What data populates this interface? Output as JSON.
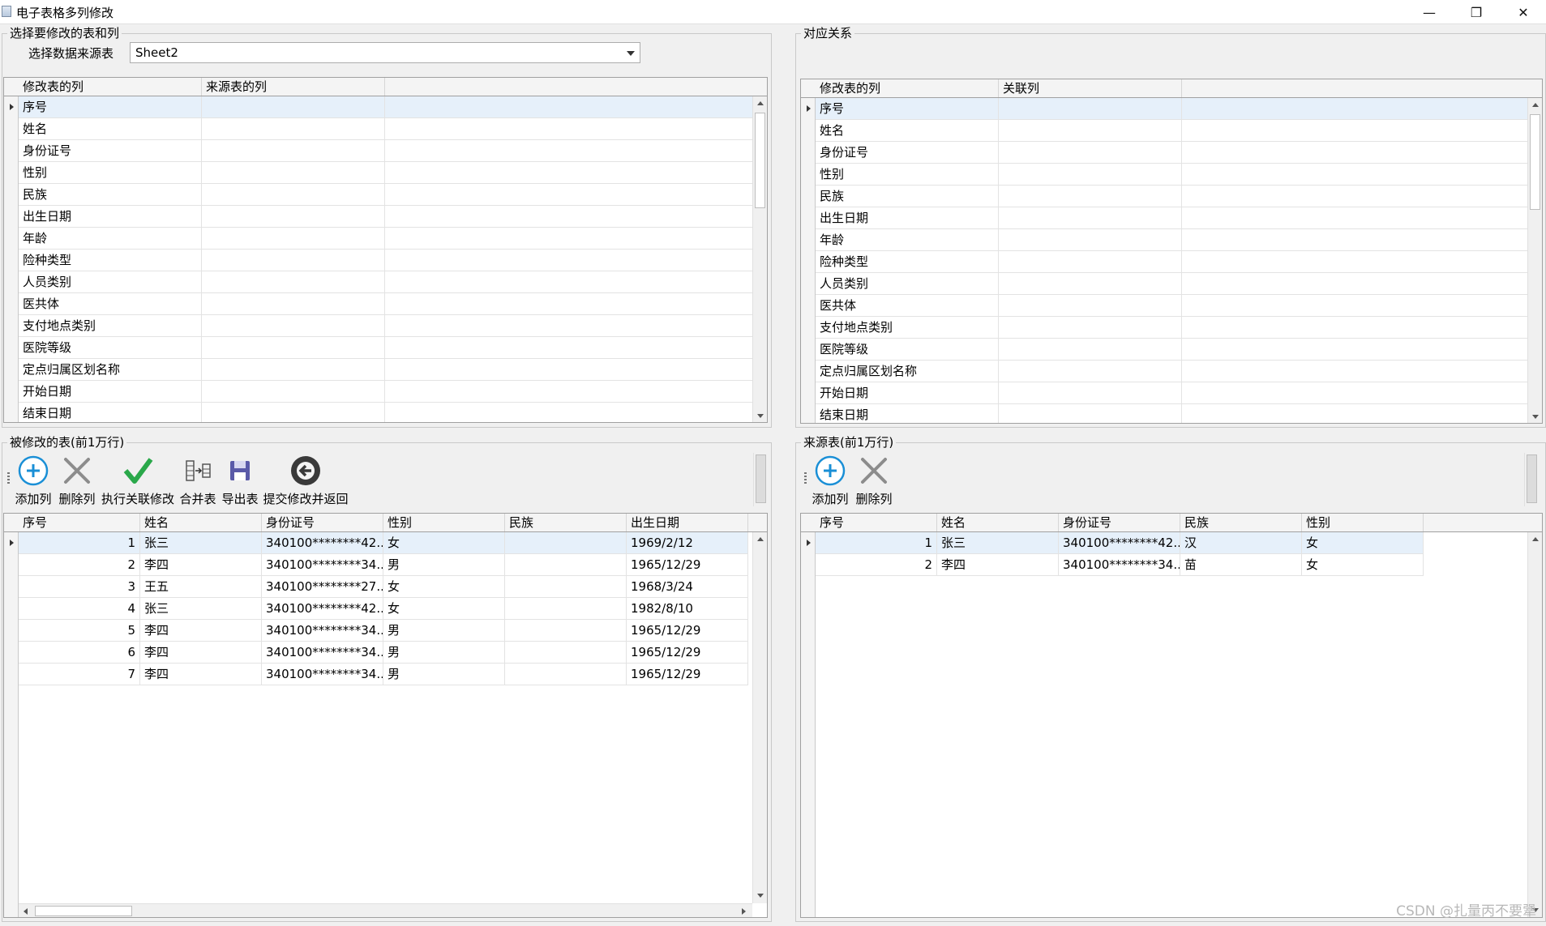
{
  "window": {
    "title": "电子表格多列修改",
    "minimize": "—",
    "restore": "❐",
    "close": "✕"
  },
  "select_group": {
    "title": "选择要修改的表和列",
    "source_label": "选择数据来源表",
    "source_value": "Sheet2",
    "columns": [
      "修改表的列",
      "来源表的列"
    ],
    "rows": [
      "序号",
      "姓名",
      "身份证号",
      "性别",
      "民族",
      "出生日期",
      "年龄",
      "险种类型",
      "人员类别",
      "医共体",
      "支付地点类别",
      "医院等级",
      "定点归属区划名称",
      "开始日期",
      "结束日期"
    ]
  },
  "mapping_group": {
    "title": "对应关系",
    "columns": [
      "修改表的列",
      "关联列"
    ],
    "rows": [
      "序号",
      "姓名",
      "身份证号",
      "性别",
      "民族",
      "出生日期",
      "年龄",
      "险种类型",
      "人员类别",
      "医共体",
      "支付地点类别",
      "医院等级",
      "定点归属区划名称",
      "开始日期",
      "结束日期"
    ]
  },
  "target_group": {
    "title": "被修改的表(前1万行)",
    "toolbar": [
      "添加列",
      "删除列",
      "执行关联修改",
      "合并表",
      "导出表",
      "提交修改并返回"
    ],
    "columns": [
      "序号",
      "姓名",
      "身份证号",
      "性别",
      "民族",
      "出生日期"
    ],
    "rows": [
      [
        "1",
        "张三",
        "340100********42...",
        "女",
        "",
        "1969/2/12"
      ],
      [
        "2",
        "李四",
        "340100********34...",
        "男",
        "",
        "1965/12/29"
      ],
      [
        "3",
        "王五",
        "340100********27...",
        "女",
        "",
        "1968/3/24"
      ],
      [
        "4",
        "张三",
        "340100********42...",
        "女",
        "",
        "1982/8/10"
      ],
      [
        "5",
        "李四",
        "340100********34...",
        "男",
        "",
        "1965/12/29"
      ],
      [
        "6",
        "李四",
        "340100********34...",
        "男",
        "",
        "1965/12/29"
      ],
      [
        "7",
        "李四",
        "340100********34...",
        "男",
        "",
        "1965/12/29"
      ]
    ]
  },
  "source_group": {
    "title": "来源表(前1万行)",
    "toolbar": [
      "添加列",
      "删除列"
    ],
    "columns": [
      "序号",
      "姓名",
      "身份证号",
      "民族",
      "性别"
    ],
    "rows": [
      [
        "1",
        "张三",
        "340100********42...",
        "汉",
        "女"
      ],
      [
        "2",
        "李四",
        "340100********34...",
        "苗",
        "女"
      ]
    ]
  },
  "watermark": "CSDN @扎量丙不要犟",
  "colors": {
    "add": "#1a8fd6",
    "delete": "#8c8c8c",
    "check": "#2aa84a",
    "save": "#5a5aa8",
    "back": "#3a3a3a",
    "selected_row": "#e6f0fa"
  }
}
